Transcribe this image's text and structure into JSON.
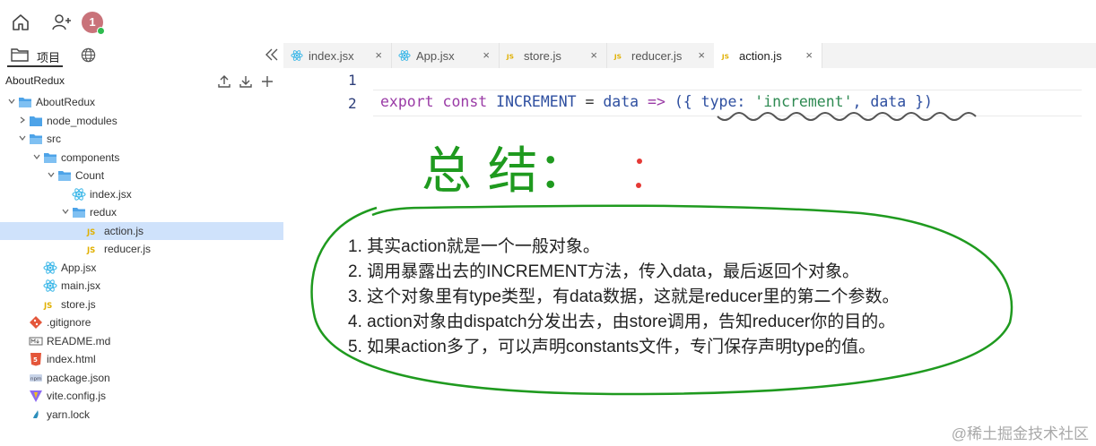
{
  "topbar": {
    "home_icon": "home-icon",
    "add_user_icon": "add-user-icon",
    "avatar_text": "1"
  },
  "sidebar": {
    "tab_label": "项目",
    "root_label": "AboutRedux",
    "tree": [
      {
        "label": "AboutRedux",
        "icon": "folder-open-icon",
        "chevron": "down"
      },
      {
        "label": "node_modules",
        "icon": "folder-icon",
        "chevron": "right"
      },
      {
        "label": "src",
        "icon": "folder-open-icon",
        "chevron": "down"
      },
      {
        "label": "components",
        "icon": "folder-open-icon",
        "chevron": "down"
      },
      {
        "label": "Count",
        "icon": "folder-open-icon",
        "chevron": "down"
      },
      {
        "label": "index.jsx",
        "icon": "react-icon",
        "chevron": ""
      },
      {
        "label": "redux",
        "icon": "folder-open-icon",
        "chevron": "down"
      },
      {
        "label": "action.js",
        "icon": "js-icon",
        "chevron": "",
        "selected": true
      },
      {
        "label": "reducer.js",
        "icon": "js-icon",
        "chevron": ""
      },
      {
        "label": "App.jsx",
        "icon": "react-icon",
        "chevron": ""
      },
      {
        "label": "main.jsx",
        "icon": "react-icon",
        "chevron": ""
      },
      {
        "label": "store.js",
        "icon": "js-icon",
        "chevron": ""
      },
      {
        "label": ".gitignore",
        "icon": "git-icon",
        "chevron": ""
      },
      {
        "label": "README.md",
        "icon": "markdown-icon",
        "chevron": ""
      },
      {
        "label": "index.html",
        "icon": "html-icon",
        "chevron": ""
      },
      {
        "label": "package.json",
        "icon": "json-icon",
        "chevron": ""
      },
      {
        "label": "vite.config.js",
        "icon": "vite-icon",
        "chevron": ""
      },
      {
        "label": "yarn.lock",
        "icon": "yarn-icon",
        "chevron": ""
      }
    ]
  },
  "tabs": [
    {
      "label": "index.jsx",
      "icon": "react-icon",
      "close": "×"
    },
    {
      "label": "App.jsx",
      "icon": "react-icon",
      "close": "×"
    },
    {
      "label": "store.js",
      "icon": "js-icon",
      "close": "×"
    },
    {
      "label": "reducer.js",
      "icon": "js-icon",
      "close": "×"
    },
    {
      "label": "action.js",
      "icon": "js-icon",
      "close": "×",
      "active": true
    }
  ],
  "editor": {
    "line_numbers": [
      "1",
      "2"
    ],
    "code": {
      "t1": "export",
      "t2": " ",
      "t3": "const",
      "t4": " INCREMENT ",
      "t5": "=",
      "t6": " data ",
      "t7": "=>",
      "t8": " ({ type: ",
      "t9": "'increment'",
      "t10": ", data })"
    }
  },
  "annotation": {
    "heading": "总 结：",
    "points": [
      "1. 其实action就是一个一般对象。",
      "2. 调用暴露出去的INCREMENT方法，传入data，最后返回个对象。",
      "3. 这个对象里有type类型，有data数据，这就是reducer里的第二个参数。",
      "4. action对象由dispatch分发出去，由store调用，告知reducer你的目的。",
      "5. 如果action多了，可以声明constants文件，专门保存声明type的值。"
    ],
    "ink_color": "#1f9a1f"
  },
  "watermark": "@稀土掘金技术社区"
}
